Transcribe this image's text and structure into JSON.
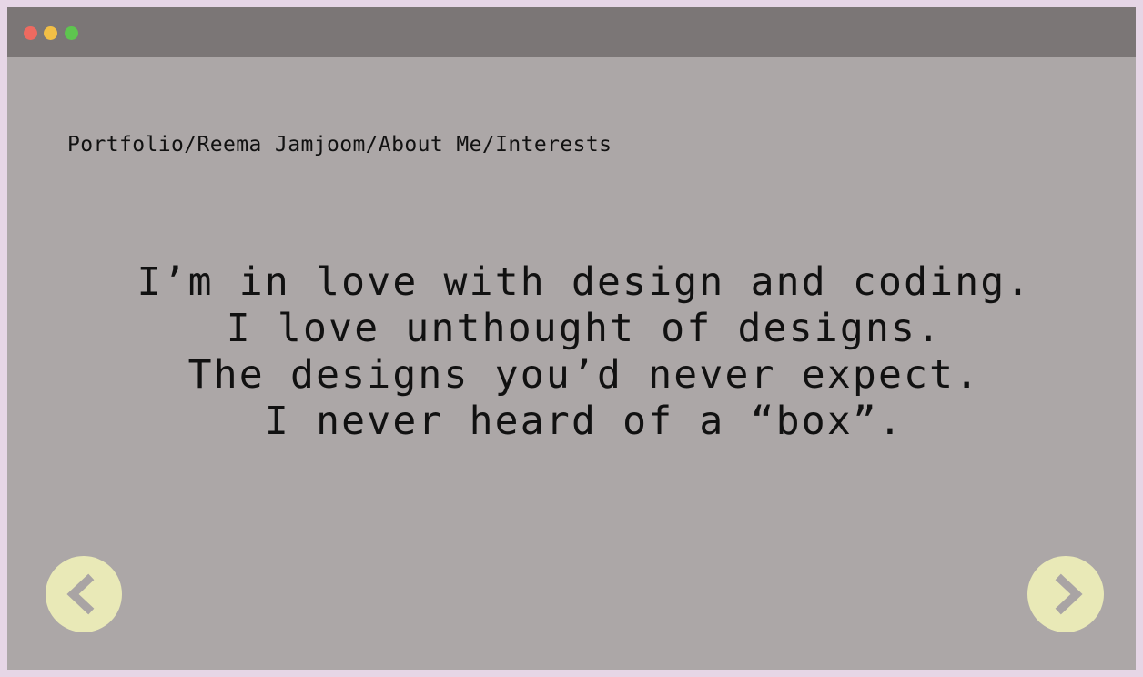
{
  "window": {
    "controls": [
      "close",
      "minimize",
      "maximize"
    ]
  },
  "breadcrumb": "Portfolio/Reema Jamjoom/About Me/Interests",
  "message": {
    "lines": [
      "I’m in love with design and coding.",
      "I love unthought of designs.",
      "The designs you’d never expect.",
      "I never heard of a “box”."
    ]
  },
  "navigation": {
    "prev_icon": "chevron-left-icon",
    "next_icon": "chevron-right-icon"
  },
  "colors": {
    "background": "#aca7a7",
    "titlebar": "#7b7676",
    "nav_button": "#e9e9b7",
    "chevron": "#a9a4a4"
  }
}
